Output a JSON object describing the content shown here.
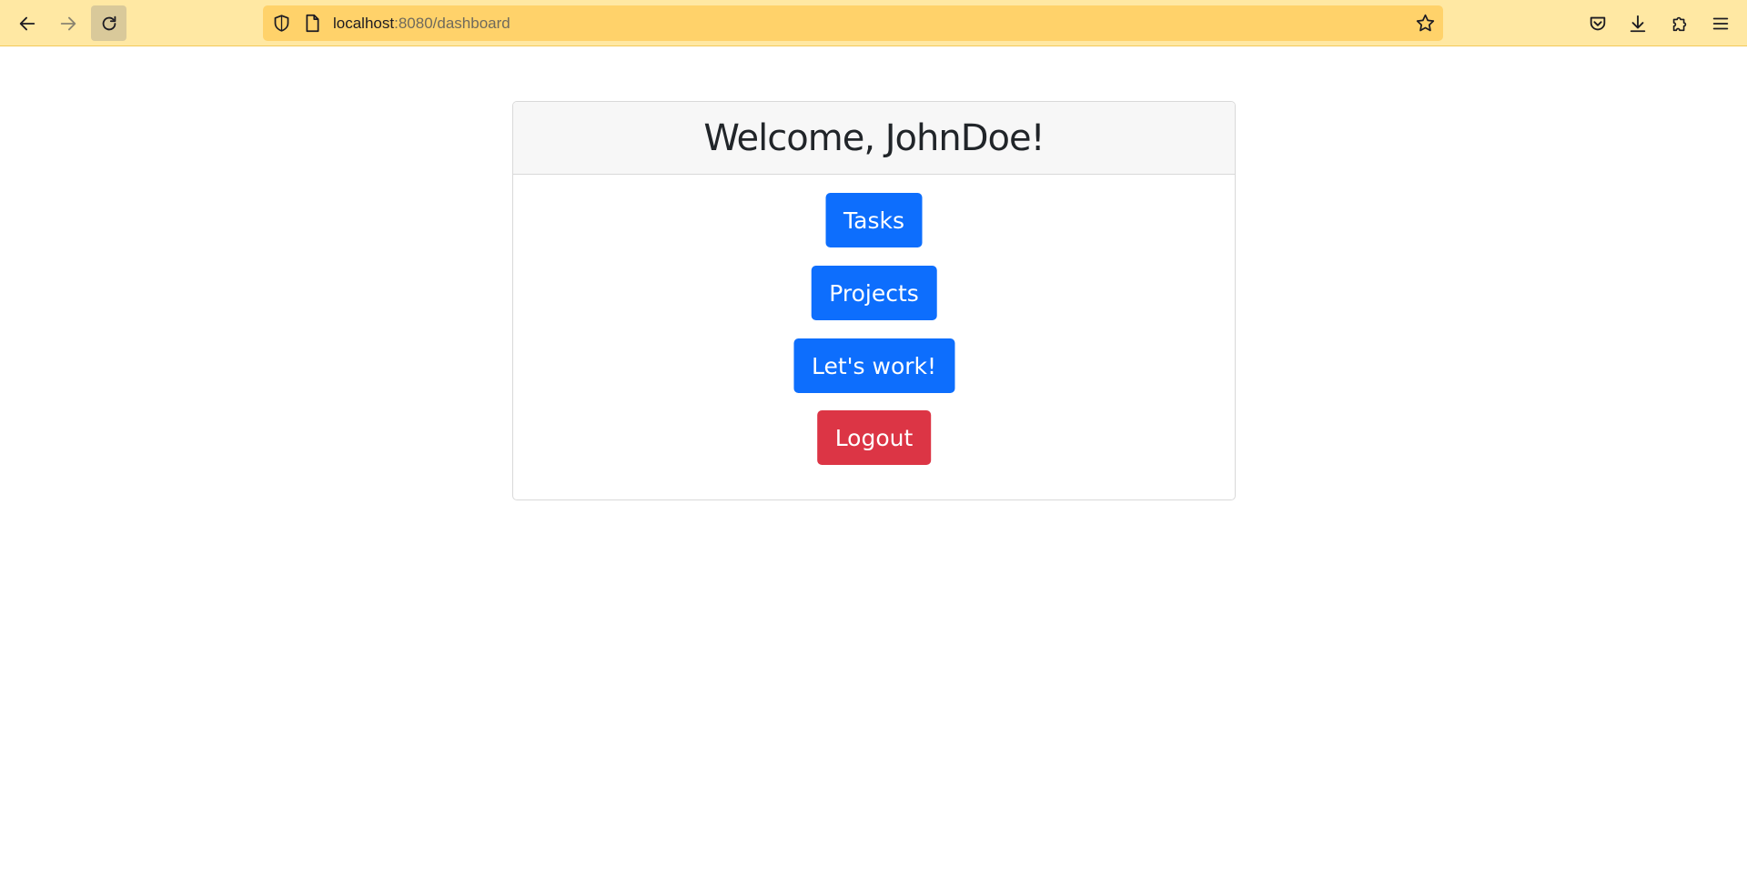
{
  "browser": {
    "url_host": "localhost",
    "url_rest": ":8080/dashboard",
    "colors": {
      "toolbar": "#ffe8a3",
      "urlbar": "#ffd26a"
    },
    "icons": {
      "back": "arrow-left-icon",
      "forward": "arrow-right-icon",
      "reload": "reload-icon",
      "shield": "shield-icon",
      "page": "page-icon",
      "bookmark": "star-icon",
      "pocket": "pocket-icon",
      "downloads": "download-icon",
      "extensions": "puzzle-icon",
      "menu": "hamburger-menu-icon"
    }
  },
  "dashboard": {
    "welcome_title": "Welcome, JohnDoe!",
    "buttons": {
      "tasks": "Tasks",
      "projects": "Projects",
      "work": "Let's work!",
      "logout": "Logout"
    },
    "colors": {
      "primary": "#0d6efd",
      "danger": "#dc3545"
    }
  }
}
